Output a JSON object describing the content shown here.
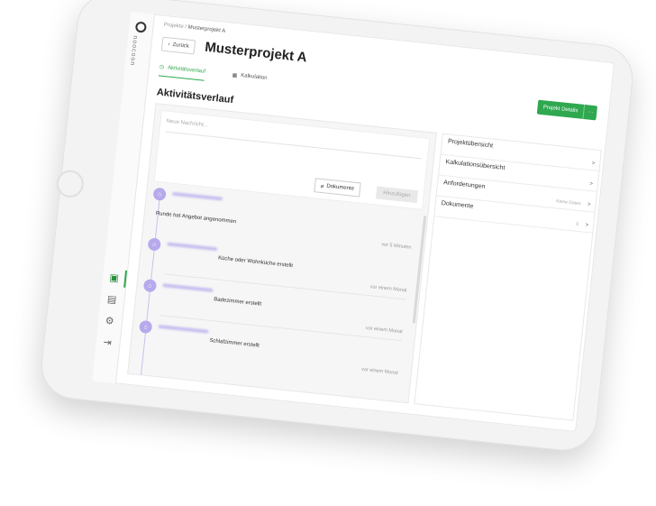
{
  "brand": {
    "name": "noocoon"
  },
  "breadcrumb": {
    "root": "Projekte",
    "separator": "/",
    "current": "Musterprojekt A"
  },
  "header": {
    "back_label": "Zurück",
    "title": "Musterprojekt A"
  },
  "tabs": [
    {
      "label": "Aktivitätsverlauf",
      "active": true
    },
    {
      "label": "Kalkulation",
      "active": false
    }
  ],
  "actions": {
    "details_label": "Projekt Details",
    "more_label": "···"
  },
  "activity": {
    "section_title": "Aktivitätsverlauf",
    "compose_placeholder": "Neue Nachricht...",
    "documents_button": "Dokumente",
    "add_button": "Hinzufügen",
    "entries": [
      {
        "text": "Runde hat Angebot angenommen",
        "time": "vor 5 Minuten"
      },
      {
        "text": "Küche oder Wohnküche erstellt",
        "time": "vor einem Monat"
      },
      {
        "text": "Badezimmer erstellt",
        "time": "vor einem Monat"
      },
      {
        "text": "Schlafzimmer erstellt",
        "time": "vor einem Monat"
      }
    ]
  },
  "side_panel": [
    {
      "label": "Projektübersicht",
      "meta": "",
      "chevron": ">"
    },
    {
      "label": "Kalkulationsübersicht",
      "meta": "",
      "chevron": ">"
    },
    {
      "label": "Anforderungen",
      "meta": "Keine Daten",
      "chevron": ">"
    },
    {
      "label": "Dokumente",
      "meta": "0",
      "chevron": ">"
    }
  ],
  "colors": {
    "accent": "#2fa84f",
    "timeline": "#b7a9ec"
  }
}
